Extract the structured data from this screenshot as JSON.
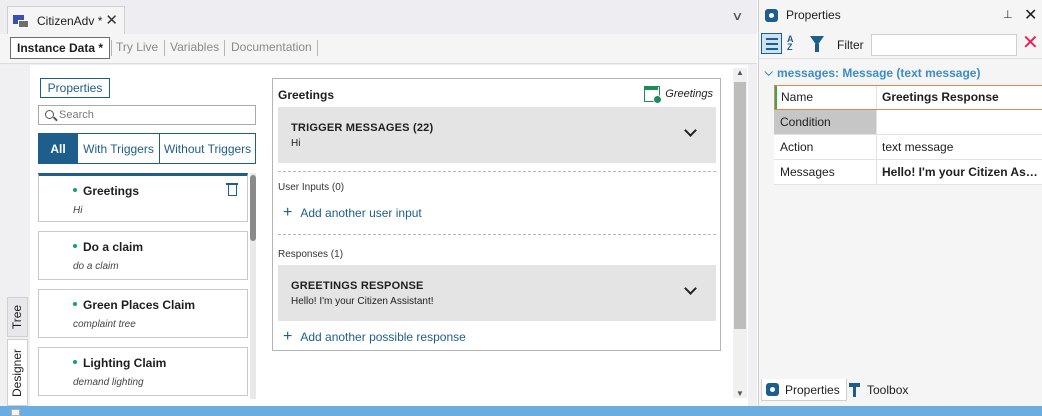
{
  "document": {
    "tab_title": "CitizenAdv *",
    "tab_close": "✕",
    "overflow_glyph": "∨",
    "subtabs": [
      {
        "label": "Instance Data *",
        "active": true
      },
      {
        "label": "Try Live",
        "active": false
      },
      {
        "label": "Variables",
        "active": false
      },
      {
        "label": "Documentation",
        "active": false
      }
    ]
  },
  "side_tabs": {
    "tree": "Tree",
    "designer": "Designer"
  },
  "list_panel": {
    "properties_button": "Properties",
    "search_placeholder": "Search",
    "filters": {
      "all": "All",
      "with": "With Triggers",
      "without": "Without Triggers"
    },
    "items": [
      {
        "title": "Greetings",
        "subtitle": "Hi",
        "selected": true
      },
      {
        "title": "Do a claim",
        "subtitle": "do a claim",
        "selected": false
      },
      {
        "title": "Green Places Claim",
        "subtitle": "complaint tree",
        "selected": false
      },
      {
        "title": "Lighting Claim",
        "subtitle": "demand lighting",
        "selected": false
      }
    ]
  },
  "detail": {
    "header": "Greetings",
    "tag_label": "Greetings",
    "trigger": {
      "title": "TRIGGER MESSAGES (22)",
      "subtitle": "Hi"
    },
    "user_inputs_label": "User Inputs (0)",
    "add_user_input": "Add another user input",
    "responses_label": "Responses (1)",
    "response": {
      "title": "GREETINGS RESPONSE",
      "subtitle": "Hello! I'm your Citizen Assistant!"
    },
    "add_response": "Add another possible response"
  },
  "properties": {
    "title": "Properties",
    "pin_glyph": "⊥",
    "close_glyph": "✕",
    "filter_label": "Filter",
    "filter_value": "",
    "clear_glyph": "✕",
    "sort_glyph": "A\nZ",
    "group": "messages: Message (text message)",
    "rows": [
      {
        "key": "Name",
        "value": "Greetings Response",
        "bold": true
      },
      {
        "key": "Condition",
        "value": "",
        "bold": false
      },
      {
        "key": "Action",
        "value": "text message",
        "bold": false
      },
      {
        "key": "Messages",
        "value": "Hello! I'm your Citizen Assistant!",
        "bold": true
      }
    ],
    "bottom_tabs": {
      "properties": "Properties",
      "toolbox": "Toolbox"
    }
  },
  "colors": {
    "accent": "#1e5e8c",
    "status_bar": "#6aaee0",
    "selection_outline": "#e3874a",
    "group_header": "#3c8dc8"
  }
}
